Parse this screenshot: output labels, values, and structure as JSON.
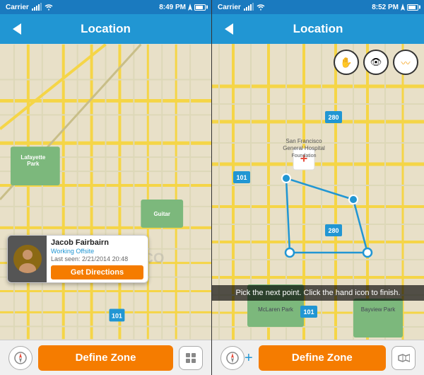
{
  "panel1": {
    "status": {
      "carrier": "Carrier",
      "time": "8:49 PM"
    },
    "header": {
      "title": "Location",
      "back_label": "Back"
    },
    "user_card": {
      "name": "Jacob Fairbairn",
      "status": "Working Offsite",
      "last_seen": "Last seen: 2/21/2014 20:48",
      "directions_btn": "Get Directions"
    },
    "bottom": {
      "define_zone_btn": "Define Zone"
    }
  },
  "panel2": {
    "status": {
      "carrier": "Carrier",
      "time": "8:52 PM"
    },
    "header": {
      "title": "Location",
      "back_label": "Back"
    },
    "toolbar": {
      "hand_icon": "✋",
      "eye_icon": "👁",
      "chart_icon": "〰"
    },
    "tooltip": "Pick the next point. Click the hand icon to finish.",
    "bottom": {
      "define_zone_btn": "Define Zone"
    }
  }
}
